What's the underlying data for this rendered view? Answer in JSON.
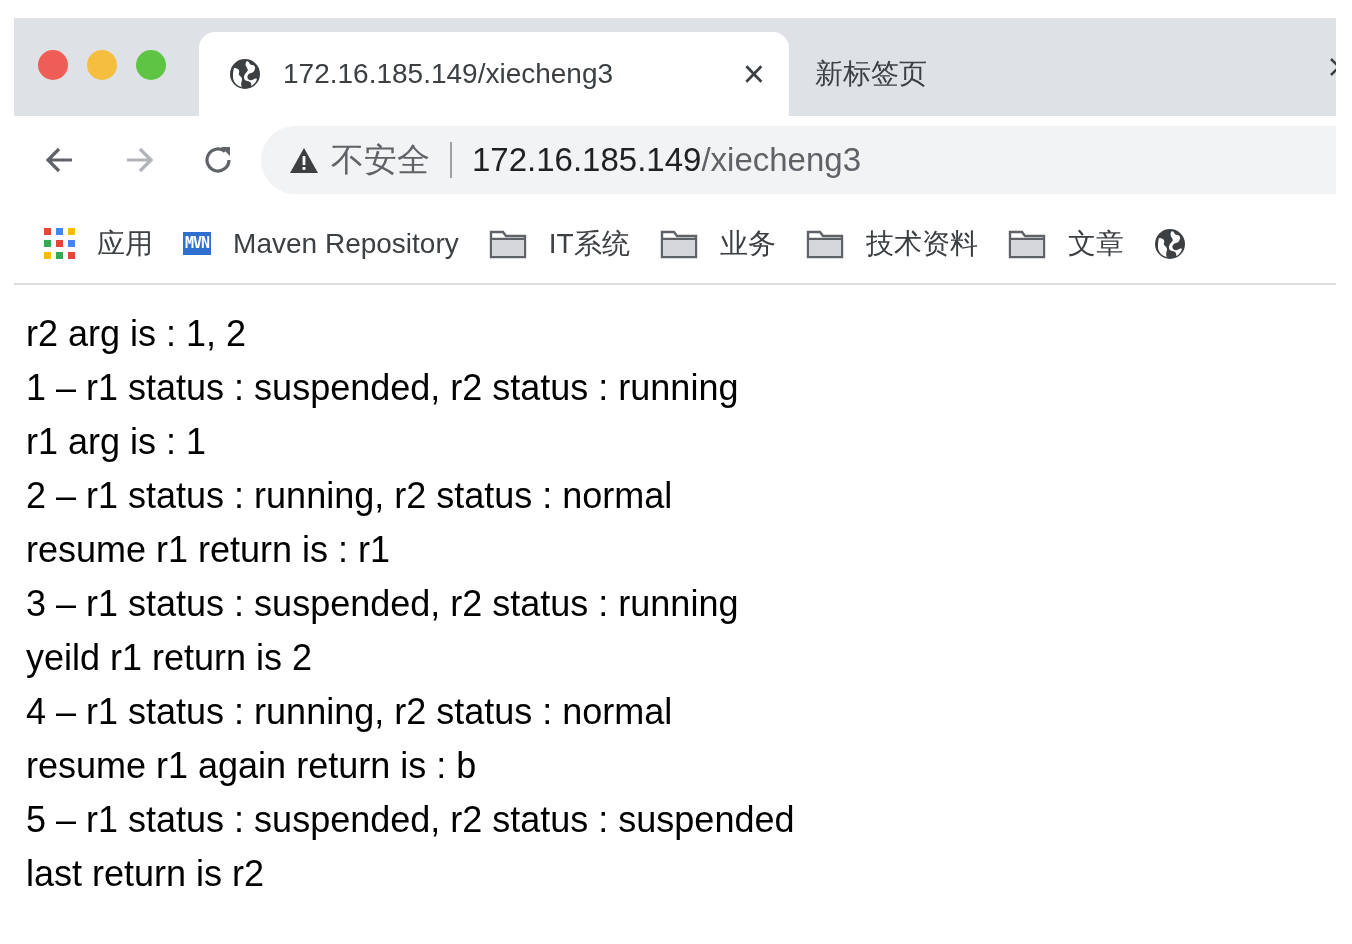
{
  "window": {
    "controls": [
      {
        "kind": "close"
      },
      {
        "kind": "minimize"
      },
      {
        "kind": "maximize"
      }
    ]
  },
  "tabs": [
    {
      "title": "172.16.185.149/xiecheng3",
      "selected": true,
      "close": "×"
    },
    {
      "title": "新标签页",
      "selected": false
    }
  ],
  "toolbar": {
    "back_disabled": false,
    "forward_disabled": true,
    "security": "不安全",
    "url_host": "172.16.185.149",
    "url_path": "/xiecheng3"
  },
  "bookmarks": [
    {
      "kind": "apps",
      "label": "应用"
    },
    {
      "kind": "mvn",
      "icon_text": "MVN",
      "label": "Maven Repository"
    },
    {
      "kind": "folder",
      "label": "IT系统"
    },
    {
      "kind": "folder",
      "label": "业务"
    },
    {
      "kind": "folder",
      "label": "技术资料"
    },
    {
      "kind": "folder",
      "label": "文章"
    },
    {
      "kind": "globe"
    }
  ],
  "content": {
    "lines": [
      "r2 arg is : 1, 2",
      "1 – r1 status : suspended, r2 status : running",
      "r1 arg is : 1",
      "2 – r1 status : running, r2 status : normal",
      "resume r1 return is : r1",
      "3 – r1 status : suspended, r2 status : running",
      "yeild r1 return is 2",
      "4 – r1 status : running, r2 status : normal",
      "resume r1 again return is : b",
      "5 – r1 status : suspended, r2 status : suspended",
      "last return is r2"
    ]
  }
}
